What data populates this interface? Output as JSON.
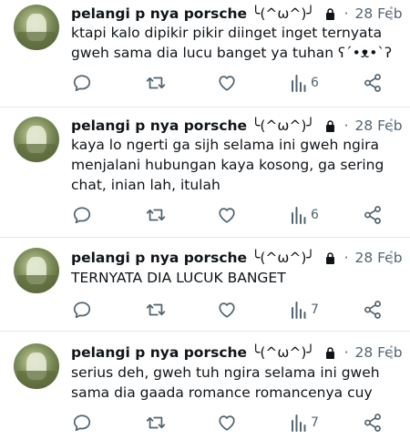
{
  "tweets": [
    {
      "name": "pelangi p nya porsche",
      "handle": "╰(^ω^)╯",
      "date": "28 Feb",
      "text": "ktapi kalo dipikir pikir diinget inget ternyata gweh sama dia lucu banget ya tuhan ʕ´•ᴥ•`ʔ",
      "views": "6"
    },
    {
      "name": "pelangi p nya porsche",
      "handle": "╰(^ω^)╯",
      "date": "28 Feb",
      "text": "kaya lo ngerti ga sijh selama ini gweh ngira menjalani hubungan kaya kosong, ga sering chat, inian lah, itulah",
      "views": "6"
    },
    {
      "name": "pelangi p nya porsche",
      "handle": "╰(^ω^)╯",
      "date": "28 Feb",
      "text": "TERNYATA DIA LUCUK BANGET",
      "views": "7"
    },
    {
      "name": "pelangi p nya porsche",
      "handle": "╰(^ω^)╯",
      "date": "28 Feb",
      "text": "serius deh, gweh tuh ngira selama ini gweh sama dia gaada romance romancenya cuy",
      "views": "7"
    }
  ],
  "colors": {
    "text": "#0f1419",
    "muted": "#536471",
    "icon": "#536471",
    "divider": "#e6e6e6"
  },
  "icons": [
    "reply-icon",
    "retweet-icon",
    "like-icon",
    "views-icon",
    "share-icon",
    "lock-icon",
    "more-icon"
  ]
}
